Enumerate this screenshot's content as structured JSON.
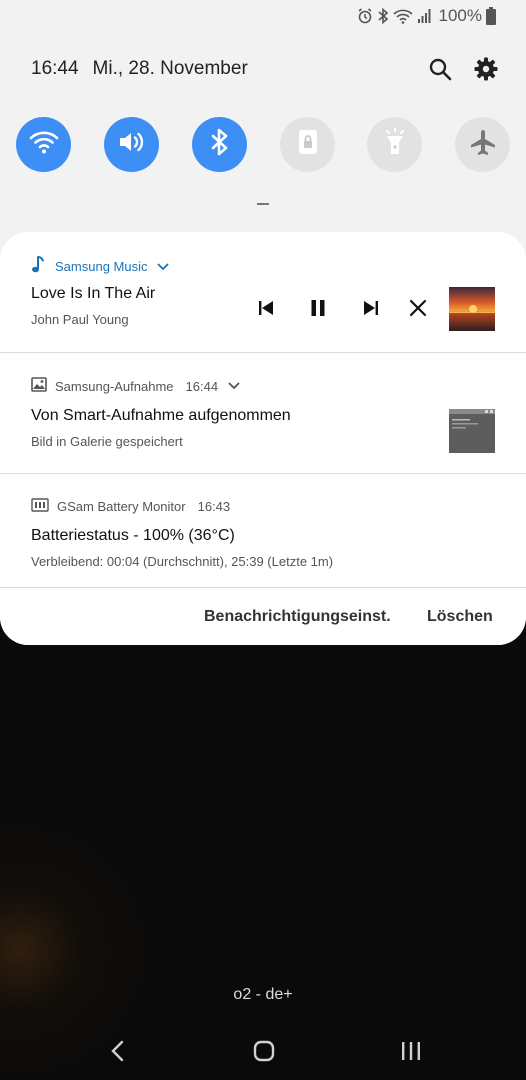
{
  "status_bar": {
    "icons": [
      "alarm-icon",
      "bluetooth-icon",
      "wifi-icon",
      "signal-icon",
      "battery-icon"
    ],
    "battery_percent": "100%"
  },
  "header": {
    "time": "16:44",
    "date": "Mi., 28. November",
    "actions": [
      "search-icon",
      "settings-icon"
    ]
  },
  "quick_settings": [
    {
      "name": "wifi",
      "icon": "wifi-icon",
      "active": true
    },
    {
      "name": "sound",
      "icon": "volume-icon",
      "active": true
    },
    {
      "name": "bluetooth",
      "icon": "bluetooth-icon",
      "active": true
    },
    {
      "name": "screen-lock",
      "icon": "lock-icon",
      "active": false
    },
    {
      "name": "flashlight",
      "icon": "flashlight-icon",
      "active": false
    },
    {
      "name": "airplane",
      "icon": "airplane-icon",
      "active": false
    }
  ],
  "notifications": {
    "music": {
      "app_name": "Samsung Music",
      "title": "Love Is In The Air",
      "artist": "John Paul Young",
      "controls": [
        "previous-icon",
        "pause-icon",
        "next-icon",
        "close-icon"
      ]
    },
    "screenshot": {
      "app_name": "Samsung-Aufnahme",
      "time": "16:44",
      "title": "Von Smart-Aufnahme aufgenommen",
      "text": "Bild in Galerie gespeichert"
    },
    "battery": {
      "app_name": "GSam Battery Monitor",
      "time": "16:43",
      "title": "Batteriestatus - 100% (36°C)",
      "text": "Verbleibend: 00:04 (Durchschnitt), 25:39 (Letzte 1m)"
    },
    "footer": {
      "settings_label": "Benachrichtigungseinst.",
      "clear_label": "Löschen"
    }
  },
  "carrier": "o2 - de+",
  "colors": {
    "accent": "#3d8ef5",
    "shade_bg": "#f2f2f2",
    "music_accent": "#1a73b8"
  }
}
